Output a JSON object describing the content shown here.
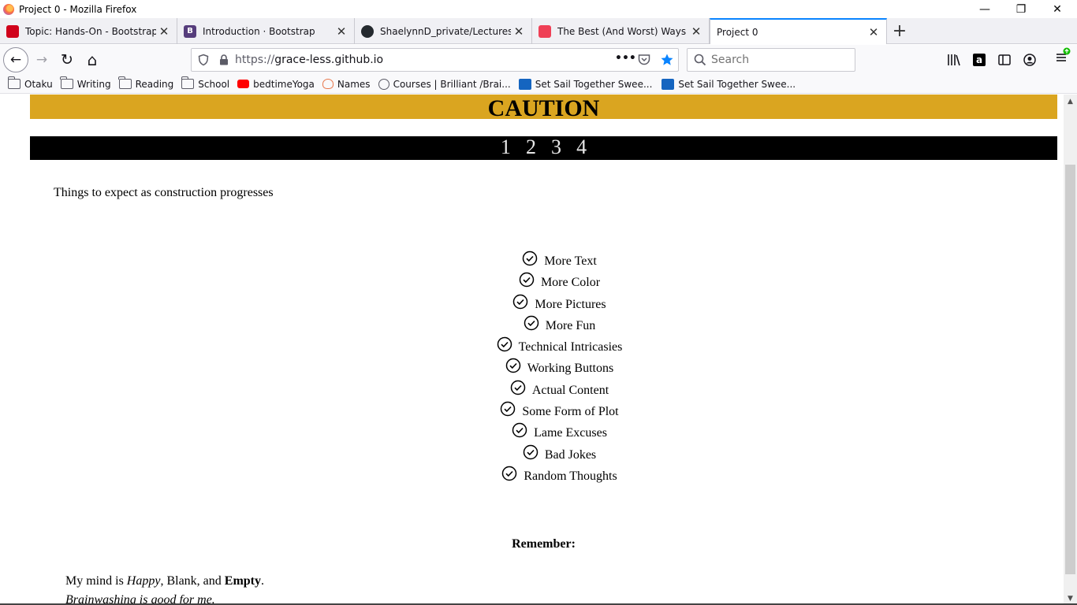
{
  "window": {
    "title": "Project 0 - Mozilla Firefox",
    "minimize": "—",
    "maximize": "❐",
    "close": "✕"
  },
  "tabs": [
    {
      "label": "Topic: Hands-On - Bootstrap up",
      "favicon_color": "#d0021b"
    },
    {
      "label": "Introduction · Bootstrap",
      "favicon_color": "#563d7c",
      "favicon_text": "B"
    },
    {
      "label": "ShaelynnD_private/Lectures/bo",
      "favicon_color": "#24292e"
    },
    {
      "label": "The Best (And Worst) Ways to S",
      "favicon_color": "#ef4056"
    },
    {
      "label": "Project 0",
      "active": true
    }
  ],
  "tab_close": "✕",
  "new_tab": "+",
  "nav": {
    "back": "←",
    "forward": "→",
    "reload": "↻",
    "home": "⌂",
    "url_scheme": "https://",
    "url_host": "grace-less.github.io",
    "page_actions": "•••",
    "search_placeholder": "Search"
  },
  "bookmarks": [
    {
      "label": "Otaku",
      "type": "folder"
    },
    {
      "label": "Writing",
      "type": "folder"
    },
    {
      "label": "Reading",
      "type": "folder"
    },
    {
      "label": "School",
      "type": "folder"
    },
    {
      "label": "bedtimeYoga",
      "type": "youtube"
    },
    {
      "label": "Names",
      "type": "names"
    },
    {
      "label": "Courses | Brilliant /Brai...",
      "type": "brilliant"
    },
    {
      "label": "Set Sail Together Swee...",
      "type": "site"
    },
    {
      "label": "Set Sail Together Swee...",
      "type": "site"
    }
  ],
  "page": {
    "banner": "CAUTION",
    "pager": [
      "1",
      "2",
      "3",
      "4"
    ],
    "intro": "Things to expect as construction progresses",
    "checklist": [
      "More Text",
      "More Color",
      "More Pictures",
      "More Fun",
      "Technical Intricasies",
      "Working Buttons",
      "Actual Content",
      "Some Form of Plot",
      "Lame Excuses",
      "Bad Jokes",
      "Random Thoughts"
    ],
    "remember": "Remember:",
    "mind": {
      "prefix": "My mind is ",
      "happy": "Happy",
      "middle": ", Blank, and ",
      "empty": "Empty",
      "suffix": "."
    },
    "brain": "Brainwashing is good for me."
  },
  "colors": {
    "banner": "#daa520",
    "pager_bg": "#000000",
    "accent": "#0a84ff"
  }
}
